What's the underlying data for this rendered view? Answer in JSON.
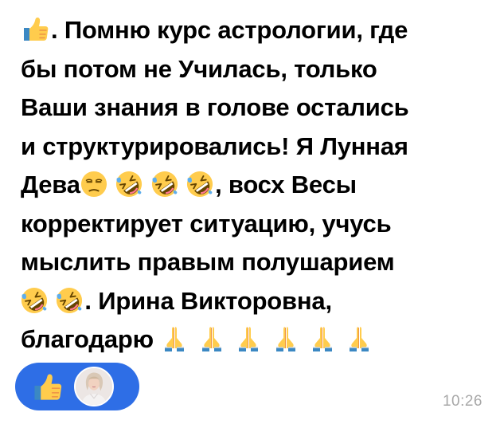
{
  "message": {
    "lines": [
      ". Помню курс астрологии, где",
      "бы потом не Училась, только",
      "Ваши знания в голове остались",
      "и структурировались! Я Лунная",
      "Дева",
      ", восх Весы",
      "корректирует ситуацию, учусь",
      "мыслить правым полушарием",
      ". Ирина Викторовна,",
      "благодарю"
    ],
    "emojis": {
      "thumbs_up": "thumbs-up-emoji",
      "unamused": "unamused-face-emoji",
      "rofl": "rolling-on-floor-laughing-emoji",
      "pray": "folded-hands-emoji"
    }
  },
  "reactions": {
    "emoji": "thumbs-up-icon",
    "reactor": "avatar"
  },
  "timestamp": "10:26",
  "colors": {
    "reaction_pill": "#2e6ee6",
    "text": "#000000",
    "timestamp": "#a8a8a8"
  }
}
